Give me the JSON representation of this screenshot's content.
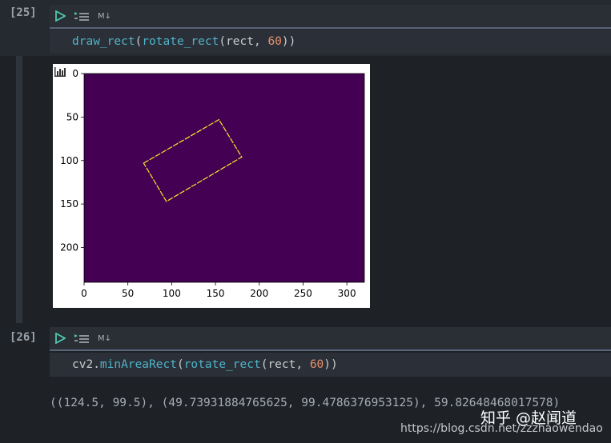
{
  "cell25": {
    "prompt": "[25]",
    "code": {
      "fn_outer": "draw_rect",
      "p1": "(",
      "fn_inner": "rotate_rect",
      "p2": "(rect, ",
      "num": "60",
      "p3": "))"
    },
    "toolbar": {
      "md_label": "M↓"
    }
  },
  "cell26": {
    "prompt": "[26]",
    "code": {
      "obj": "cv2.",
      "fn_outer": "minAreaRect",
      "p1": "(",
      "fn_inner": "rotate_rect",
      "p2": "(rect, ",
      "num": "60",
      "p3": "))"
    },
    "toolbar": {
      "md_label": "M↓"
    },
    "output": "((124.5, 99.5), (49.73931884765625, 99.4786376953125), 59.82648468017578)"
  },
  "watermark": {
    "cn": "知乎 @赵闻道",
    "url": "https://blog.csdn.net/zzzhaowendao"
  },
  "colors": {
    "plot_bg": "#440154",
    "rect_line": "#fde725",
    "toolbar_border": "#5a6478"
  },
  "icons": [
    "run-icon",
    "run-lines-icon",
    "markdown-icon",
    "chart-icon"
  ],
  "chart_data": {
    "type": "image",
    "title": "",
    "xlabel": "",
    "ylabel": "",
    "xlim": [
      0,
      320
    ],
    "ylim": [
      240,
      0
    ],
    "xticks": [
      0,
      50,
      100,
      150,
      200,
      250,
      300
    ],
    "yticks": [
      0,
      50,
      100,
      150,
      200
    ],
    "grid": false,
    "polygon": [
      [
        68,
        103
      ],
      [
        154,
        53
      ],
      [
        180,
        96
      ],
      [
        94,
        147
      ]
    ],
    "background": "#440154",
    "line_color": "#fde725"
  }
}
